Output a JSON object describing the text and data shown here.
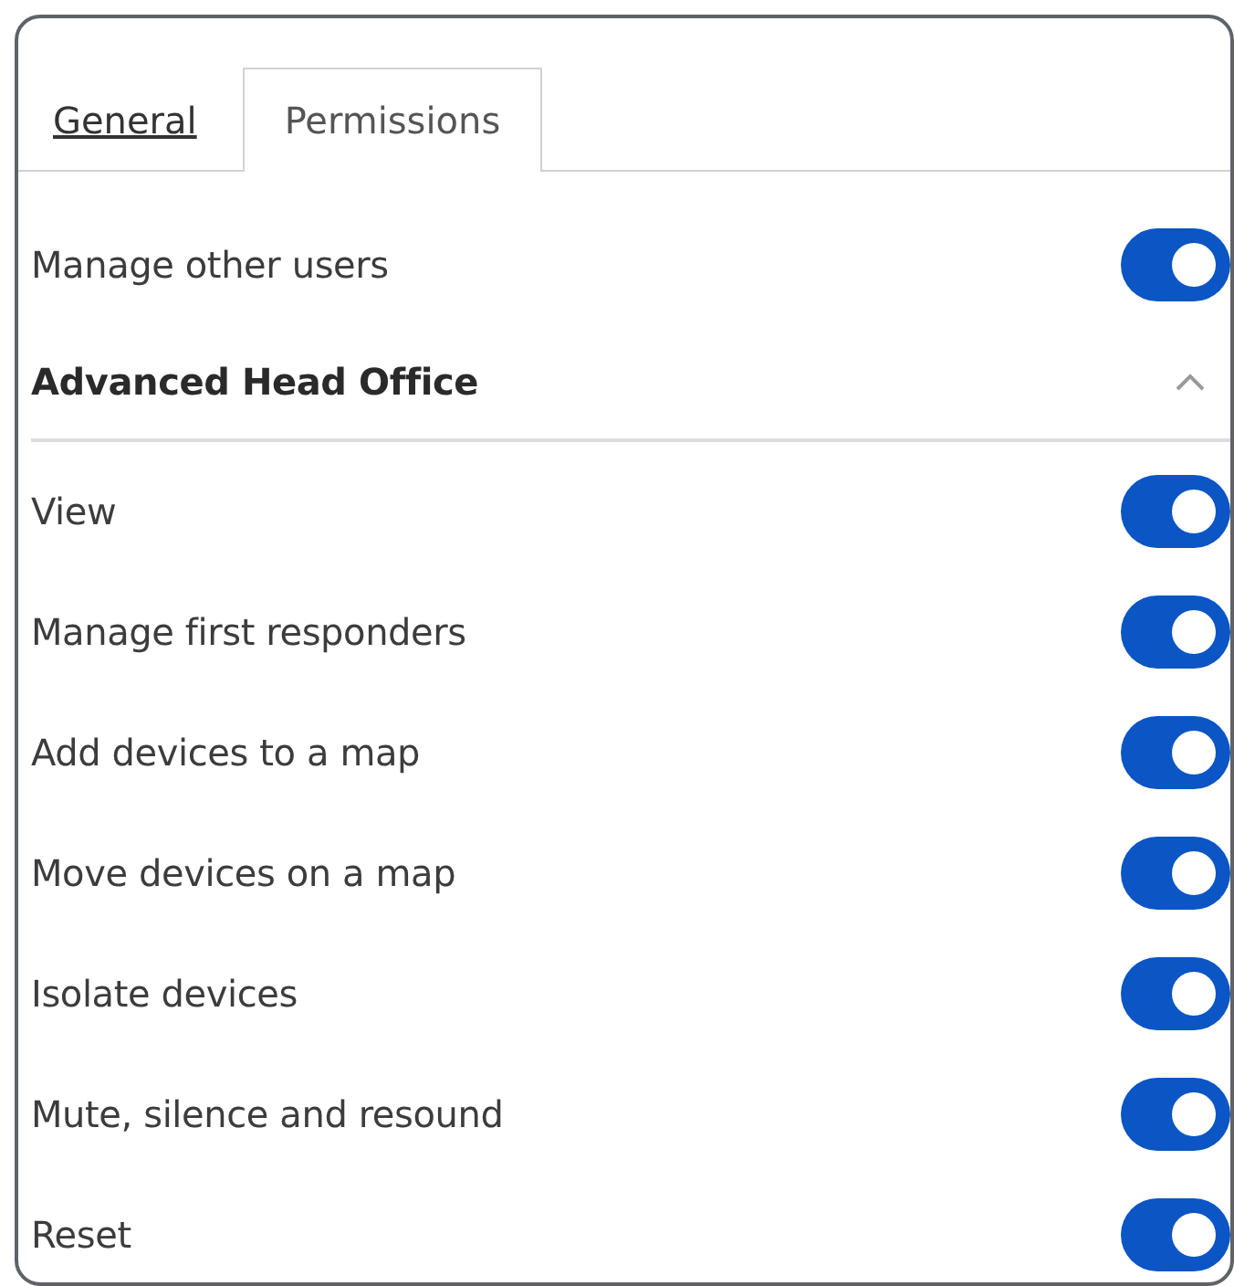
{
  "tabs": [
    {
      "label": "General",
      "selected": false
    },
    {
      "label": "Permissions",
      "selected": true
    }
  ],
  "permissions": [
    {
      "label": "Manage other users",
      "on": true
    }
  ],
  "section": {
    "title": "Advanced Head Office",
    "expanded": true,
    "items": [
      {
        "label": "View",
        "on": true
      },
      {
        "label": "Manage first responders",
        "on": true
      },
      {
        "label": "Add devices to a map",
        "on": true
      },
      {
        "label": "Move devices on a map",
        "on": true
      },
      {
        "label": "Isolate devices",
        "on": true
      },
      {
        "label": "Mute, silence and resound",
        "on": true
      },
      {
        "label": "Reset",
        "on": true
      }
    ]
  }
}
